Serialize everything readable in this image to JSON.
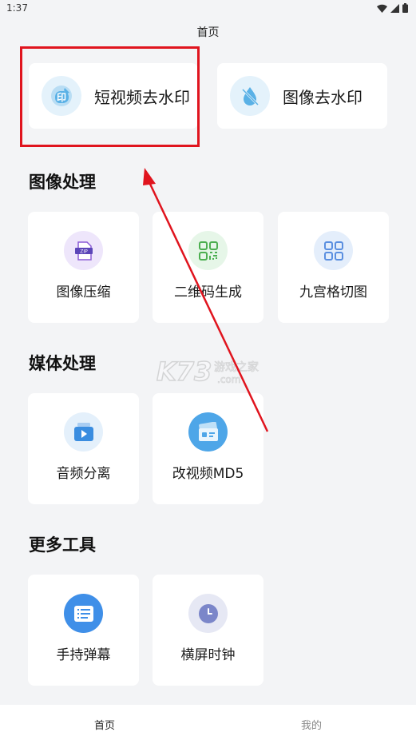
{
  "status_bar": {
    "time": "1:37"
  },
  "header": {
    "title": "首页"
  },
  "top_features": [
    {
      "label": "短视频去水印",
      "icon": "video-watermark-icon",
      "icon_char": "印"
    },
    {
      "label": "图像去水印",
      "icon": "image-watermark-drop-icon"
    }
  ],
  "sections": [
    {
      "title": "图像处理",
      "items": [
        {
          "label": "图像压缩",
          "icon": "zip-icon",
          "icon_text": "ZIP"
        },
        {
          "label": "二维码生成",
          "icon": "qrcode-icon"
        },
        {
          "label": "九宫格切图",
          "icon": "grid-icon"
        }
      ]
    },
    {
      "title": "媒体处理",
      "items": [
        {
          "label": "音频分离",
          "icon": "audio-video-icon"
        },
        {
          "label": "改视频MD5",
          "icon": "video-card-icon"
        }
      ]
    },
    {
      "title": "更多工具",
      "items": [
        {
          "label": "手持弹幕",
          "icon": "bullet-screen-icon"
        },
        {
          "label": "横屏时钟",
          "icon": "clock-icon"
        }
      ]
    }
  ],
  "bottom_nav": {
    "home": "首页",
    "mine": "我的"
  },
  "watermark": {
    "logo": "K73",
    "site_name": "游戏之家",
    "domain": ".com"
  },
  "colors": {
    "accent_red": "#e0141e",
    "blue": "#4a90e2",
    "green": "#4caf50",
    "purple": "#8c5cd6",
    "nav_active": "#222222",
    "nav_inactive": "#888888"
  }
}
